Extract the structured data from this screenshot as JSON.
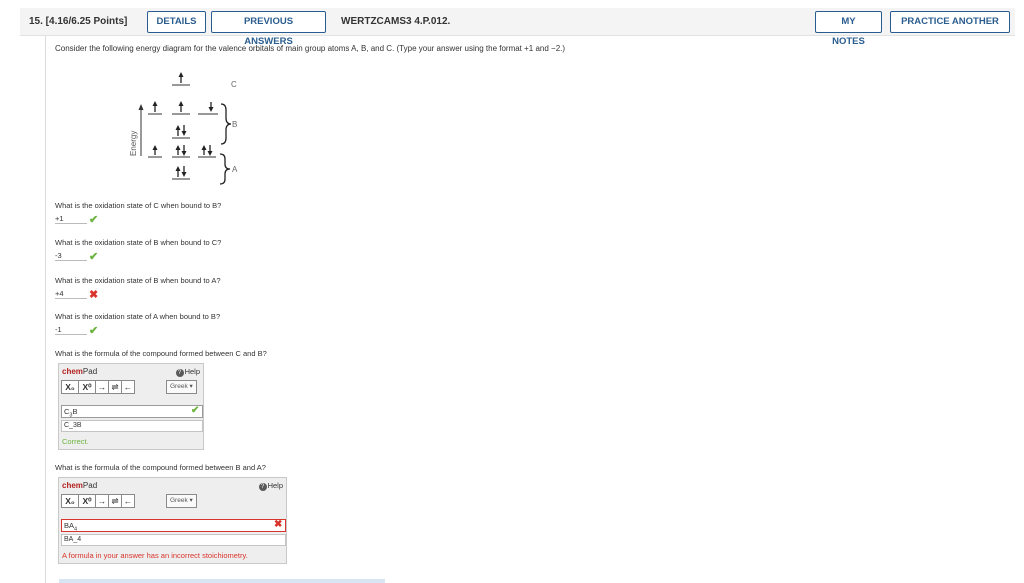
{
  "header": {
    "question_label": "15. [4.16/6.25 Points]",
    "details_label": "DETAILS",
    "previous_answers_label": "PREVIOUS ANSWERS",
    "problem_code": "WERTZCAMS3 4.P.012.",
    "my_notes_label": "MY NOTES",
    "practice_another_label": "PRACTICE ANOTHER"
  },
  "prompt": "Consider the following energy diagram for the valence orbitals of main group atoms A, B, and C. (Type your answer using the format +1 and −2.)",
  "diagram": {
    "energy_label": "Energy",
    "label_c": "C",
    "label_b": "B",
    "label_a": "A"
  },
  "questions": [
    {
      "text": "What is the oxidation state of C when bound to B?",
      "answer": "+1",
      "status": "correct"
    },
    {
      "text": "What is the oxidation state of B when bound to C?",
      "answer": "-3",
      "status": "correct"
    },
    {
      "text": "What is the oxidation state of B when bound to A?",
      "answer": "+4",
      "status": "incorrect"
    },
    {
      "text": "What is the oxidation state of A when bound to B?",
      "answer": "-1",
      "status": "correct"
    }
  ],
  "formula_questions": [
    {
      "text": "What is the formula of the compound formed between C and B?",
      "chempad": "chem",
      "chempad_suffix": "Pad",
      "help": "Help",
      "toolbar": [
        "X₀",
        "X⁰",
        "→",
        "⇌",
        "←"
      ],
      "greek": "Greek ▾",
      "input_base": "C",
      "input_sub": "3",
      "input_rest": "B",
      "raw": "C_3B",
      "feedback": "Correct.",
      "status": "correct"
    },
    {
      "text": "What is the formula of the compound formed between B and A?",
      "chempad": "chem",
      "chempad_suffix": "Pad",
      "help": "Help",
      "toolbar": [
        "X₀",
        "X⁰",
        "→",
        "⇌",
        "←"
      ],
      "greek": "Greek ▾",
      "input_base": "BA",
      "input_sub": "4",
      "input_rest": "",
      "raw": "BA_4",
      "feedback": "A formula in your answer has an incorrect stoichiometry.",
      "status": "incorrect"
    }
  ],
  "icons": {
    "correct": "check-icon",
    "incorrect": "x-icon",
    "help": "help-circle-icon"
  },
  "colors": {
    "accent": "#2a5d8f",
    "correct": "#6cb33f",
    "incorrect": "#d9342b",
    "chempad_title": "#b41f1f"
  }
}
